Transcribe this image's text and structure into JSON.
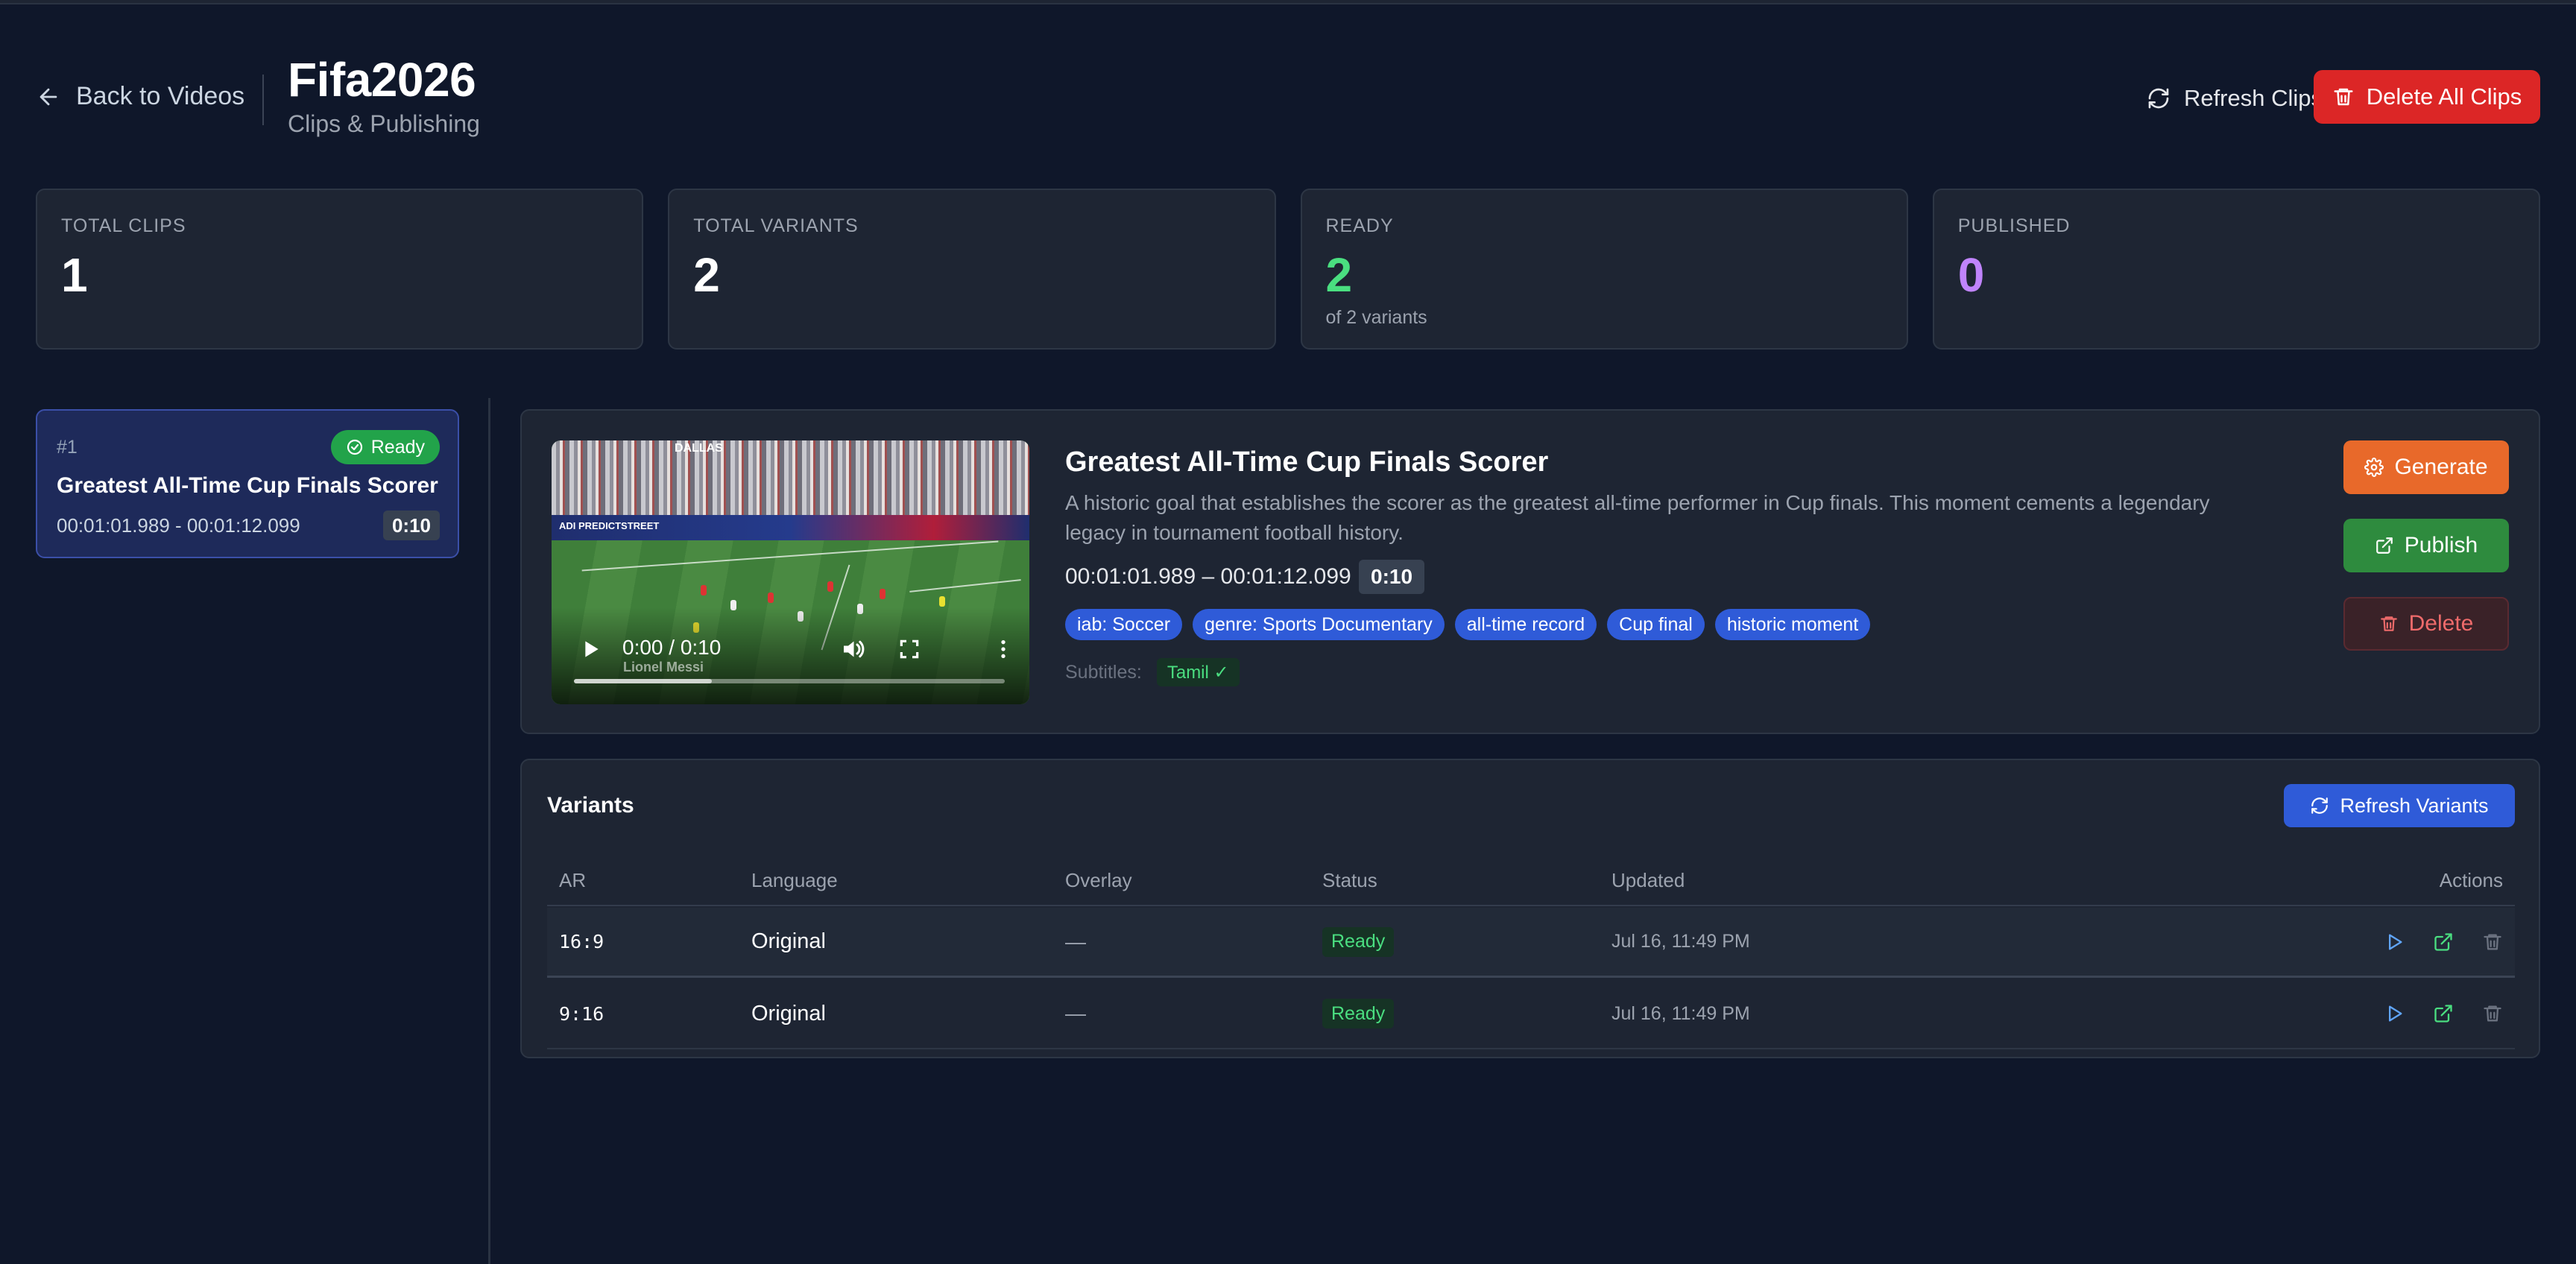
{
  "header": {
    "back_label": "Back to Videos",
    "title": "Fifa2026",
    "subtitle": "Clips & Publishing",
    "refresh_label": "Refresh Clips",
    "delete_all_label": "Delete All Clips"
  },
  "stats": {
    "total_clips": {
      "label": "TOTAL CLIPS",
      "value": "1"
    },
    "total_variants": {
      "label": "TOTAL VARIANTS",
      "value": "2"
    },
    "ready": {
      "label": "READY",
      "value": "2",
      "sub": "of 2 variants",
      "color": "#4ade80"
    },
    "published": {
      "label": "PUBLISHED",
      "value": "0",
      "color": "#c084fc"
    }
  },
  "clip_list": [
    {
      "num": "#1",
      "status": "Ready",
      "title": "Greatest All-Time Cup Finals Scorer",
      "time_range": "00:01:01.989 - 00:01:12.099",
      "duration": "0:10"
    }
  ],
  "detail": {
    "title": "Greatest All-Time Cup Finals Scorer",
    "description": "A historic goal that establishes the scorer as the greatest all-time performer in Cup finals. This moment cements a legendary legacy in tournament football history.",
    "time_range": "00:01:01.989 – 00:01:12.099",
    "duration": "0:10",
    "tags": [
      "iab: Soccer",
      "genre: Sports Documentary",
      "all-time record",
      "Cup final",
      "historic moment"
    ],
    "subtitles_label": "Subtitles:",
    "subtitles_value": "Tamil ✓",
    "generate_label": "Generate",
    "publish_label": "Publish",
    "delete_label": "Delete",
    "video": {
      "time_display": "0:00 / 0:10",
      "progress_fraction": 0,
      "stadium_text": "DALLAS",
      "banner_text": "ADI PREDICTSTREET",
      "caption_text": "Lionel Messi"
    }
  },
  "variants": {
    "title": "Variants",
    "refresh_label": "Refresh Variants",
    "columns": [
      "AR",
      "Language",
      "Overlay",
      "Status",
      "Updated",
      "Actions"
    ],
    "rows": [
      {
        "ar": "16:9",
        "language": "Original",
        "overlay": "—",
        "status": "Ready",
        "updated": "Jul 16, 11:49 PM"
      },
      {
        "ar": "9:16",
        "language": "Original",
        "overlay": "—",
        "status": "Ready",
        "updated": "Jul 16, 11:49 PM"
      }
    ]
  },
  "colors": {
    "background": "#0f172a",
    "card": "#1e2533",
    "danger": "#dc2626",
    "success": "#22a34a",
    "accent_blue": "#2f5bd8",
    "generate_orange": "#e8692a",
    "publish_green": "#2e8b3e",
    "icon_play_blue": "#60a5fa",
    "icon_open_green": "#4ade80",
    "icon_delete_gray": "#6b7280"
  },
  "icons": {
    "back": "arrow-left-icon",
    "refresh": "refresh-icon",
    "trash": "trash-icon",
    "check_circle": "check-circle-icon",
    "gear": "gear-icon",
    "external_link": "external-link-icon",
    "play": "play-icon",
    "volume": "volume-icon",
    "fullscreen": "fullscreen-icon",
    "more": "more-vertical-icon"
  }
}
